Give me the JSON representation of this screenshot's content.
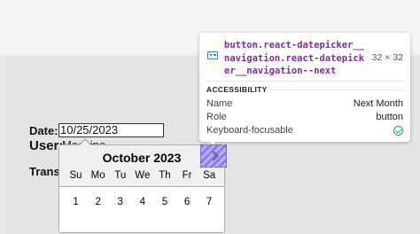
{
  "form": {
    "date_label": "Date:",
    "date_value": "10/25/2023",
    "user_label": "User:",
    "user_value": "Machine",
    "trans_label": "Transa"
  },
  "datepicker": {
    "month": "October 2023",
    "weekdays": [
      "Su",
      "Mo",
      "Tu",
      "We",
      "Th",
      "Fr",
      "Sa"
    ],
    "visible_week": [
      "1",
      "2",
      "3",
      "4",
      "5",
      "6",
      "7"
    ]
  },
  "inspector": {
    "selector": "button.react-datepicker__navigation.react-datepicker__navigation--next",
    "size": "32 × 32",
    "section_title": "ACCESSIBILITY",
    "rows": [
      {
        "key": "Name",
        "value": "Next Month"
      },
      {
        "key": "Role",
        "value": "button"
      },
      {
        "key": "Keyboard-focusable",
        "value": ""
      }
    ],
    "accent_color": "#6a55d8",
    "check_color": "#22a05a"
  }
}
